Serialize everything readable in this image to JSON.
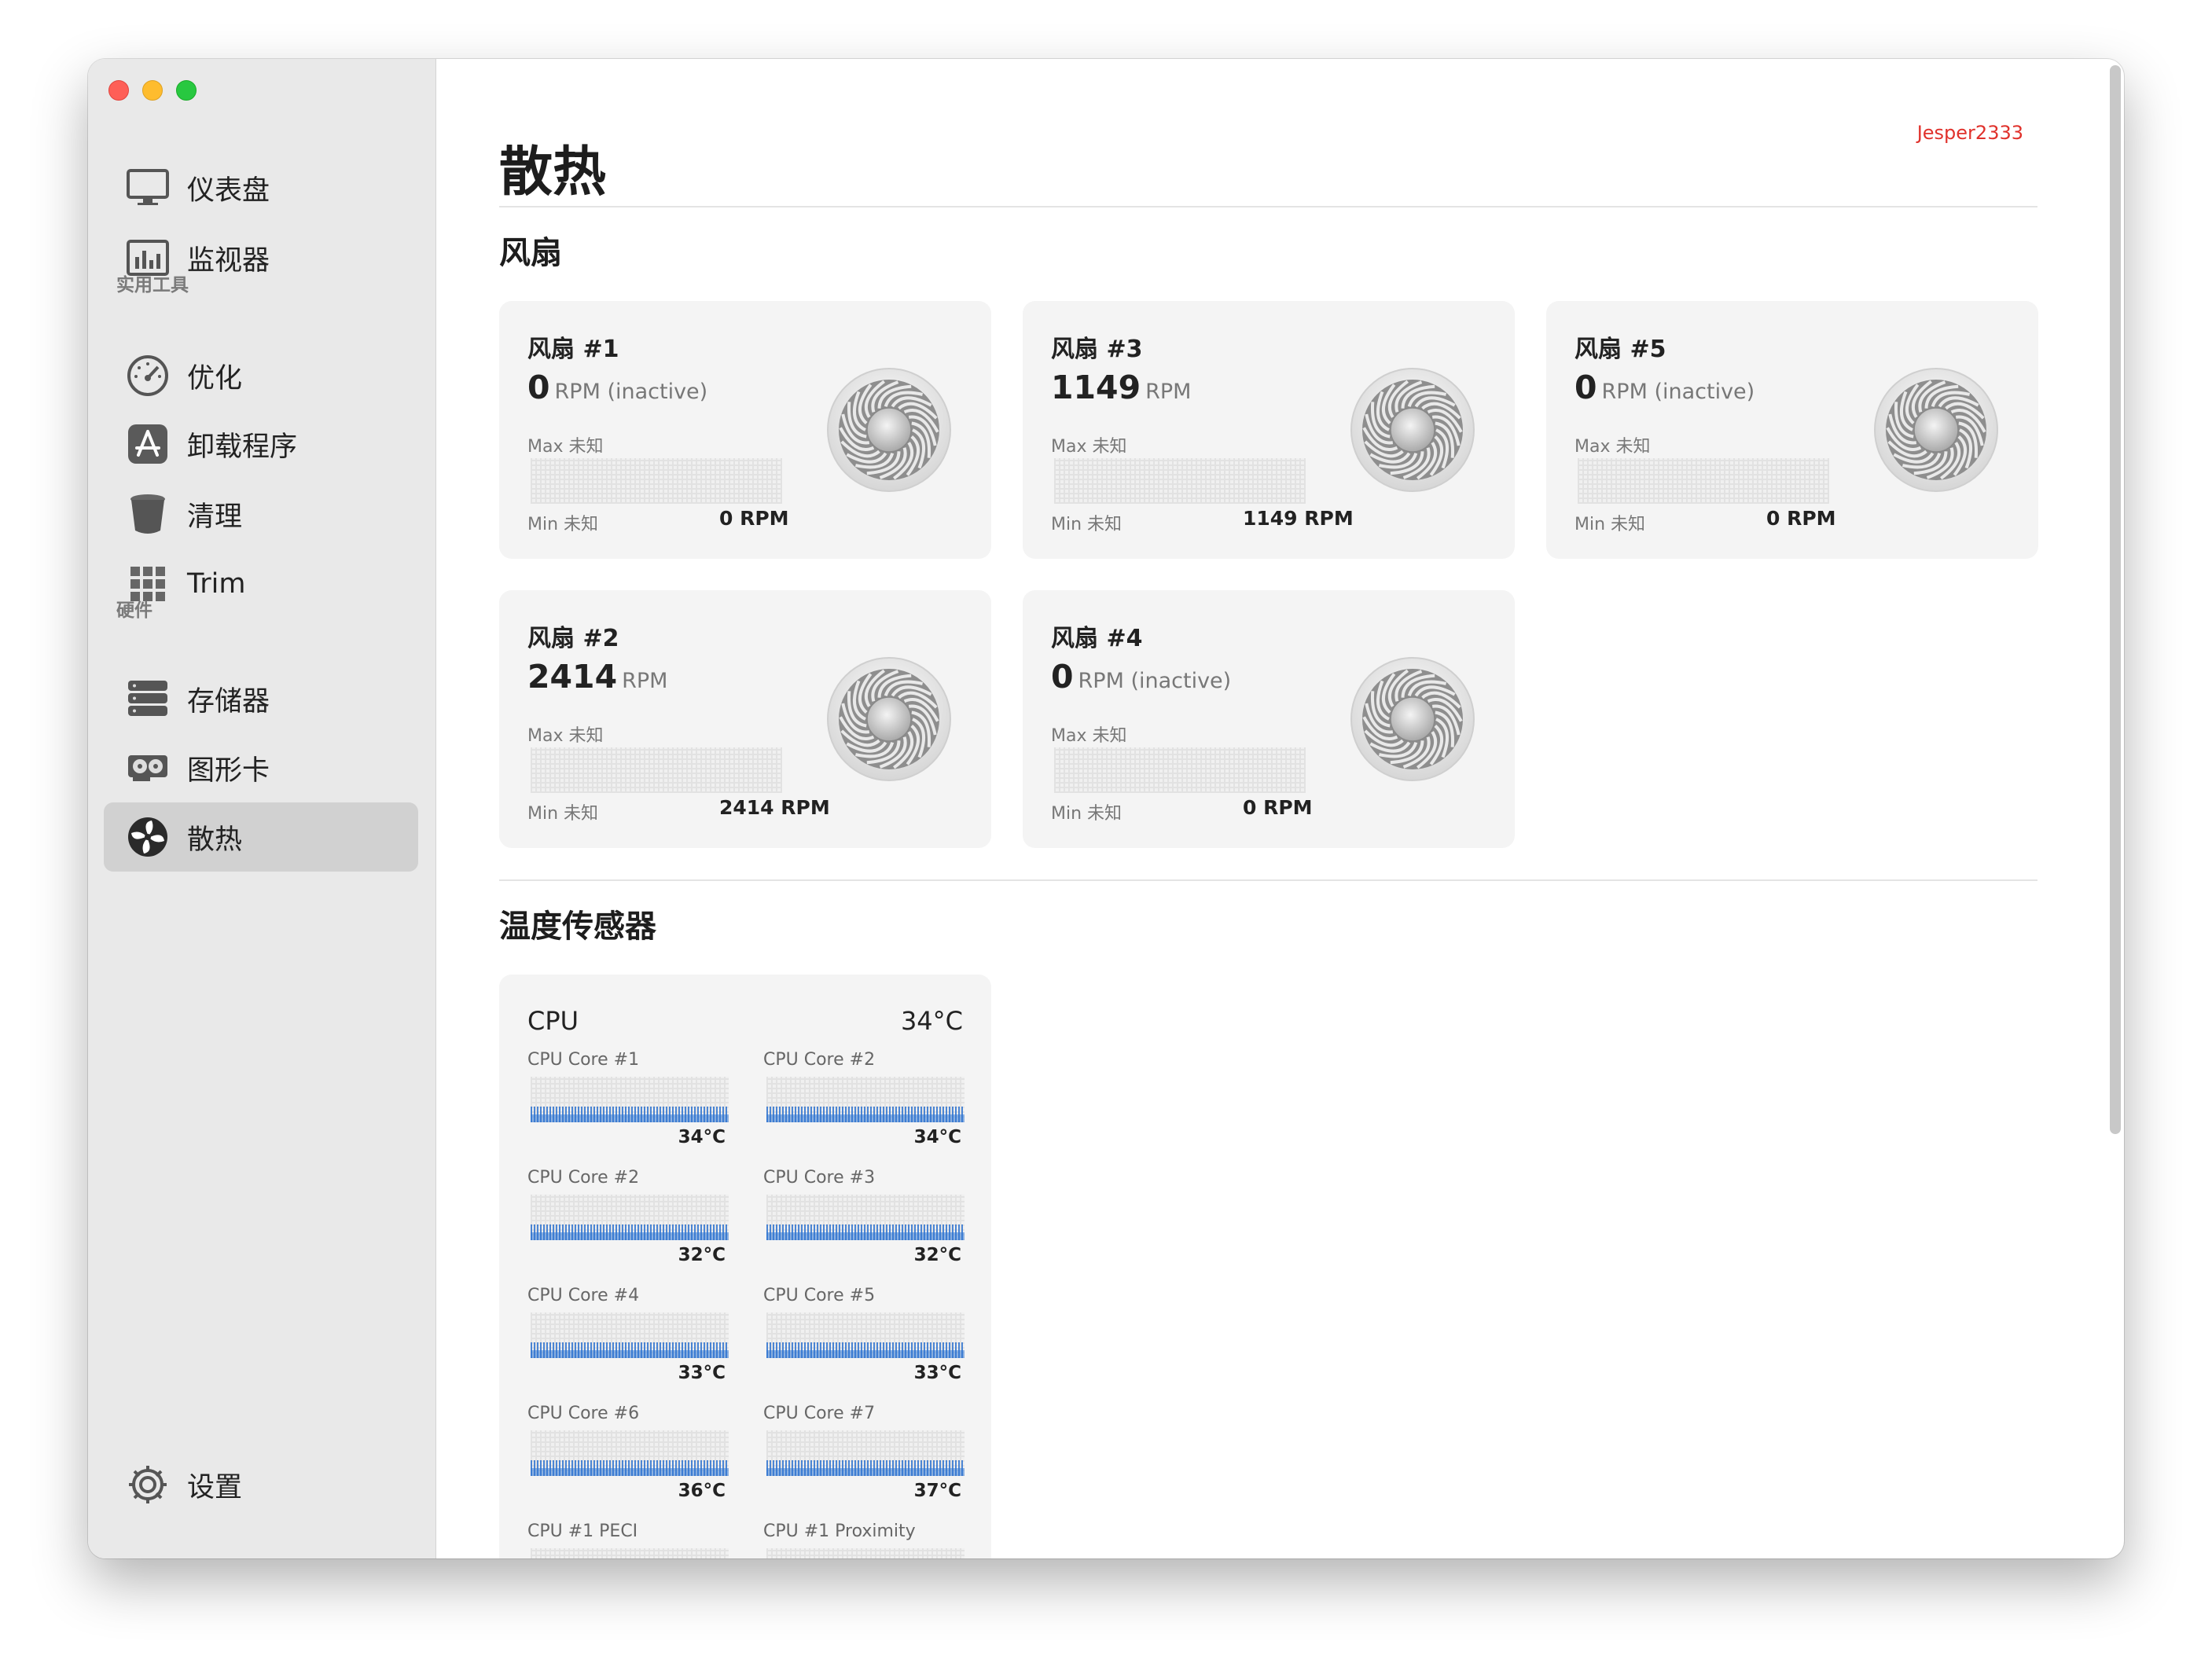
{
  "sidebar": {
    "items_top": [
      {
        "label": "仪表盘",
        "icon": "monitor-icon"
      },
      {
        "label": "监视器",
        "icon": "chart-bars-icon"
      }
    ],
    "section_tools": "实用工具",
    "items_tools": [
      {
        "label": "优化",
        "icon": "speedometer-icon"
      },
      {
        "label": "卸载程序",
        "icon": "app-store-icon"
      },
      {
        "label": "清理",
        "icon": "bin-icon"
      },
      {
        "label": "Trim",
        "icon": "grid-icon"
      }
    ],
    "section_hardware": "硬件",
    "items_hardware": [
      {
        "label": "存储器",
        "icon": "storage-icon"
      },
      {
        "label": "图形卡",
        "icon": "gpu-icon"
      },
      {
        "label": "散热",
        "icon": "fan-icon",
        "active": true
      }
    ],
    "settings": {
      "label": "设置",
      "icon": "gear-icon"
    }
  },
  "main": {
    "title": "散热",
    "user": "Jesper2333",
    "fans_title": "风扇",
    "sensors_title": "温度传感器"
  },
  "fans": [
    {
      "name": "风扇 #1",
      "rpm": "0",
      "unit": "RPM (inactive)",
      "max": "Max 未知",
      "min": "Min 未知",
      "current": "0 RPM"
    },
    {
      "name": "风扇 #3",
      "rpm": "1149",
      "unit": "RPM",
      "max": "Max 未知",
      "min": "Min 未知",
      "current": "1149 RPM"
    },
    {
      "name": "风扇 #5",
      "rpm": "0",
      "unit": "RPM (inactive)",
      "max": "Max 未知",
      "min": "Min 未知",
      "current": "0 RPM"
    },
    {
      "name": "风扇 #2",
      "rpm": "2414",
      "unit": "RPM",
      "max": "Max 未知",
      "min": "Min 未知",
      "current": "2414 RPM"
    },
    {
      "name": "风扇 #4",
      "rpm": "0",
      "unit": "RPM (inactive)",
      "max": "Max 未知",
      "min": "Min 未知",
      "current": "0 RPM"
    }
  ],
  "sensor_group": {
    "name": "CPU",
    "value": "34°C",
    "cores": [
      {
        "name": "CPU Core #1",
        "value": "34°C"
      },
      {
        "name": "CPU Core #2",
        "value": "34°C"
      },
      {
        "name": "CPU Core #2",
        "value": "32°C"
      },
      {
        "name": "CPU Core #3",
        "value": "32°C"
      },
      {
        "name": "CPU Core #4",
        "value": "33°C"
      },
      {
        "name": "CPU Core #5",
        "value": "33°C"
      },
      {
        "name": "CPU Core #6",
        "value": "36°C"
      },
      {
        "name": "CPU Core #7",
        "value": "37°C"
      },
      {
        "name": "CPU #1 PECI",
        "value": ""
      },
      {
        "name": "CPU #1 Proximity",
        "value": ""
      }
    ]
  },
  "colors": {
    "accent_user": "#e0312b",
    "graph_blue": "#2f74d0",
    "sidebar_bg": "#e9e9e9",
    "card_bg": "#f4f4f4"
  }
}
